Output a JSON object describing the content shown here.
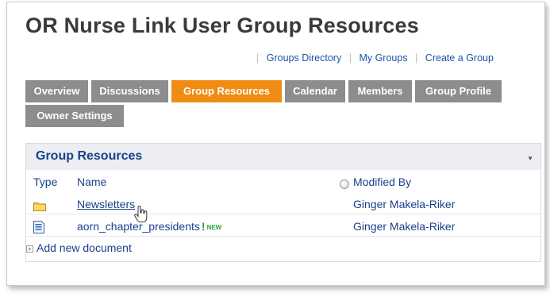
{
  "page": {
    "title": "OR Nurse Link User Group Resources"
  },
  "toplinks": [
    "Groups Directory",
    "My Groups",
    "Create a Group"
  ],
  "tabs": [
    {
      "label": "Overview",
      "active": false
    },
    {
      "label": "Discussions",
      "active": false
    },
    {
      "label": "Group Resources",
      "active": true
    },
    {
      "label": "Calendar",
      "active": false
    },
    {
      "label": "Members",
      "active": false
    },
    {
      "label": "Group Profile",
      "active": false
    },
    {
      "label": "Owner Settings",
      "active": false
    }
  ],
  "panel": {
    "title": "Group Resources",
    "menu_icon": "dropdown-caret",
    "columns": {
      "type": "Type",
      "name": "Name",
      "modified_by": "Modified By"
    },
    "rows": [
      {
        "icon": "folder-icon",
        "name": "Newsletters",
        "modified_by": "Ginger Makela-Riker"
      },
      {
        "icon": "document-icon",
        "name": "aorn_chapter_presidents",
        "badge_mark": "!",
        "badge_text": "NEW",
        "modified_by": "Ginger Makela-Riker"
      }
    ],
    "add_link": "Add new document",
    "add_icon": "expand-icon"
  },
  "colors": {
    "tab_active": "#f08c14",
    "tab_inactive": "#8d8d8d",
    "link": "#1b3f8c",
    "new_badge": "#2fa52f"
  }
}
